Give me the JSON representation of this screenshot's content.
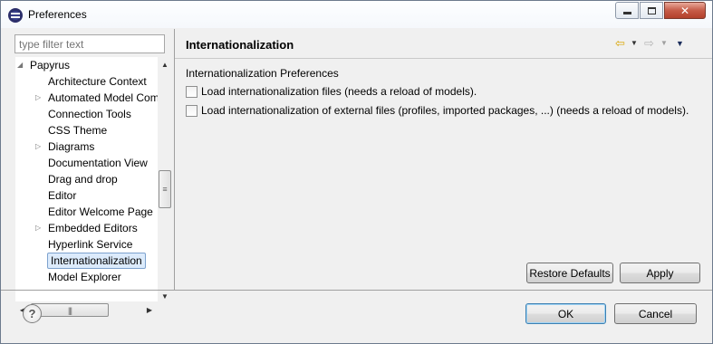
{
  "window": {
    "title": "Preferences",
    "minimize_icon": "minimize-icon",
    "maximize_icon": "maximize-icon",
    "close_icon": "close-icon"
  },
  "filter": {
    "placeholder": "type filter text",
    "value": ""
  },
  "tree": {
    "items": [
      {
        "label": "Papyrus",
        "expander": "expanded",
        "level": 0
      },
      {
        "label": "Architecture Context",
        "expander": "none",
        "level": 1
      },
      {
        "label": "Automated Model Completion",
        "expander": "collapsed",
        "level": 1
      },
      {
        "label": "Connection Tools",
        "expander": "none",
        "level": 1
      },
      {
        "label": "CSS Theme",
        "expander": "none",
        "level": 1
      },
      {
        "label": "Diagrams",
        "expander": "collapsed",
        "level": 1
      },
      {
        "label": "Documentation View",
        "expander": "none",
        "level": 1
      },
      {
        "label": "Drag and drop",
        "expander": "none",
        "level": 1
      },
      {
        "label": "Editor",
        "expander": "none",
        "level": 1
      },
      {
        "label": "Editor Welcome Page",
        "expander": "none",
        "level": 1
      },
      {
        "label": "Embedded Editors",
        "expander": "collapsed",
        "level": 1
      },
      {
        "label": "Hyperlink Service",
        "expander": "none",
        "level": 1
      },
      {
        "label": "Internationalization",
        "expander": "none",
        "level": 1,
        "selected": true
      },
      {
        "label": "Model Explorer",
        "expander": "none",
        "level": 1
      }
    ]
  },
  "page": {
    "title": "Internationalization",
    "section_label": "Internationalization Preferences",
    "checkboxes": [
      {
        "label": "Load internationalization files (needs a reload of models).",
        "checked": false
      },
      {
        "label": "Load internationalization of external files (profiles, imported packages, ...) (needs a reload of models).",
        "checked": false
      }
    ],
    "restore_defaults_label": "Restore Defaults",
    "apply_label": "Apply"
  },
  "footer": {
    "help_glyph": "?",
    "ok_label": "OK",
    "cancel_label": "Cancel"
  },
  "colors": {
    "selection_bg": "#dcebfc",
    "selection_border": "#7da2ce",
    "back_arrow": "#d9a400",
    "close_button": "#c65b47"
  }
}
